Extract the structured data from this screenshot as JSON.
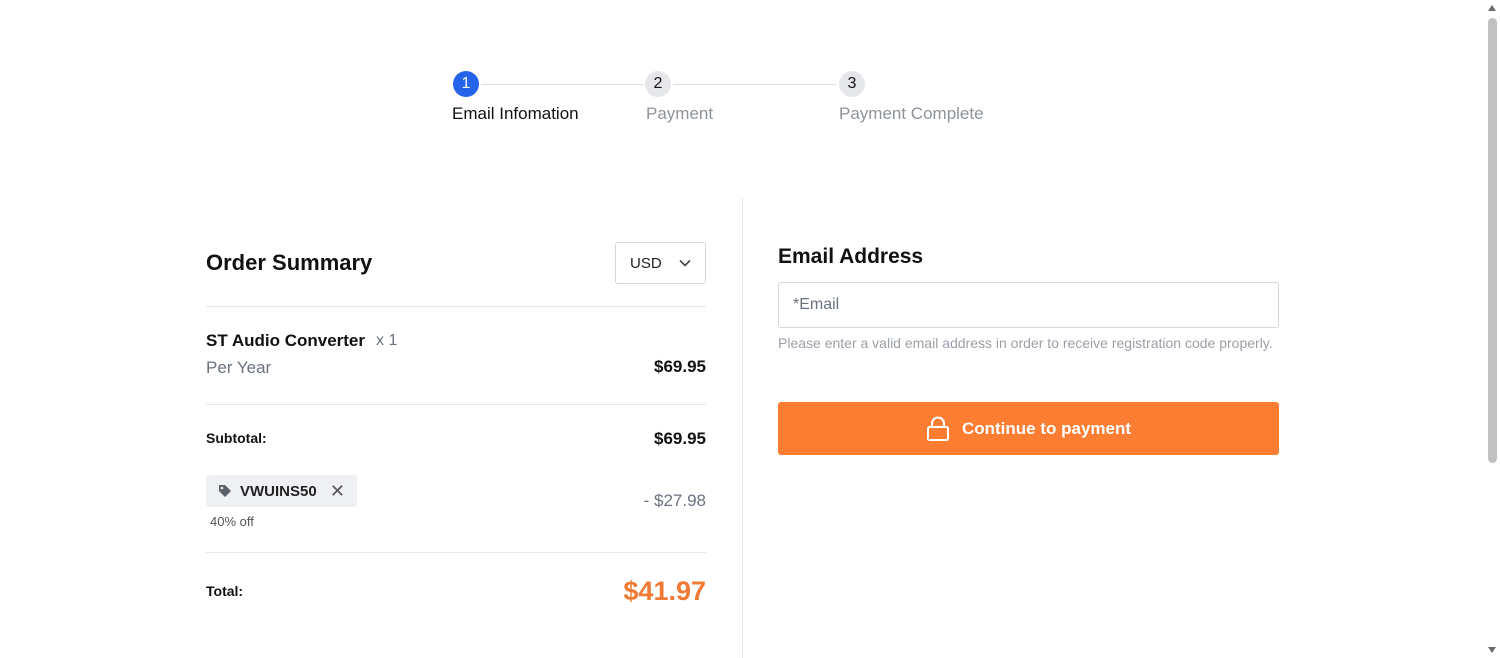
{
  "steps": [
    {
      "number": "1",
      "label": "Email Infomation"
    },
    {
      "number": "2",
      "label": "Payment"
    },
    {
      "number": "3",
      "label": "Payment Complete"
    }
  ],
  "order_summary": {
    "title": "Order Summary",
    "currency": "USD",
    "product": {
      "name": "ST Audio Converter",
      "quantity": "x 1",
      "period": "Per Year",
      "price": "$69.95"
    },
    "subtotal_label": "Subtotal:",
    "subtotal_value": "$69.95",
    "coupon": {
      "code": "VWUINS50",
      "off": "40% off",
      "discount": "- $27.98"
    },
    "total_label": "Total:",
    "total_value": "$41.97"
  },
  "email": {
    "title": "Email Address",
    "placeholder": "*Email",
    "hint": "Please enter a valid email address in order to receive registration code properly.",
    "button_label": "Continue to payment"
  },
  "colors": {
    "active_step": "#2563eb",
    "accent": "#fd7d32",
    "total": "#f07a33"
  }
}
